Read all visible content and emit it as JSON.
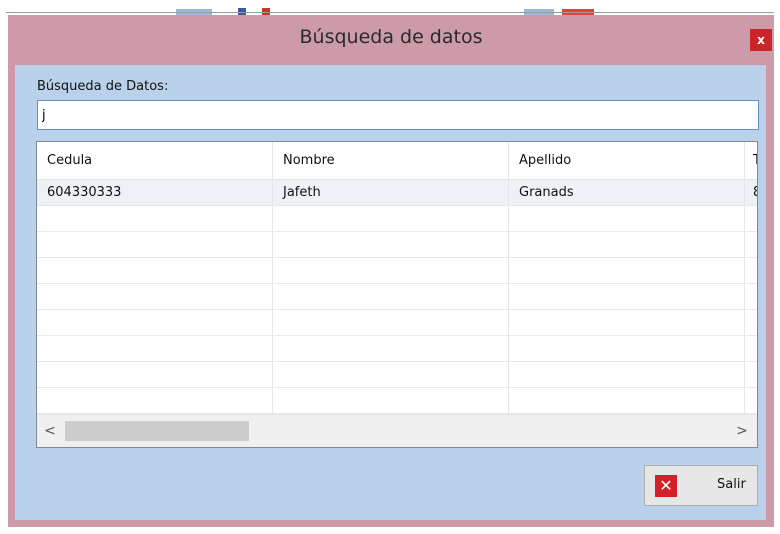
{
  "window": {
    "title": "Búsqueda de datos",
    "close_label": "x"
  },
  "search": {
    "label": "Búsqueda de Datos:",
    "value": "j"
  },
  "table": {
    "columns": [
      "Cedula",
      "Nombre",
      "Apellido",
      "T"
    ],
    "rows": [
      [
        "604330333",
        "Jafeth",
        "Granads",
        "8"
      ]
    ]
  },
  "scrollbar": {
    "left_arrow": "<",
    "right_arrow": ">"
  },
  "actions": {
    "salir_label": "Salir",
    "salir_icon": "✕"
  },
  "colors": {
    "title_bar": "#cc9aa9",
    "client_bg": "#b9d1ea",
    "close_button": "#c8262a",
    "salir_icon": "#d4202a"
  }
}
